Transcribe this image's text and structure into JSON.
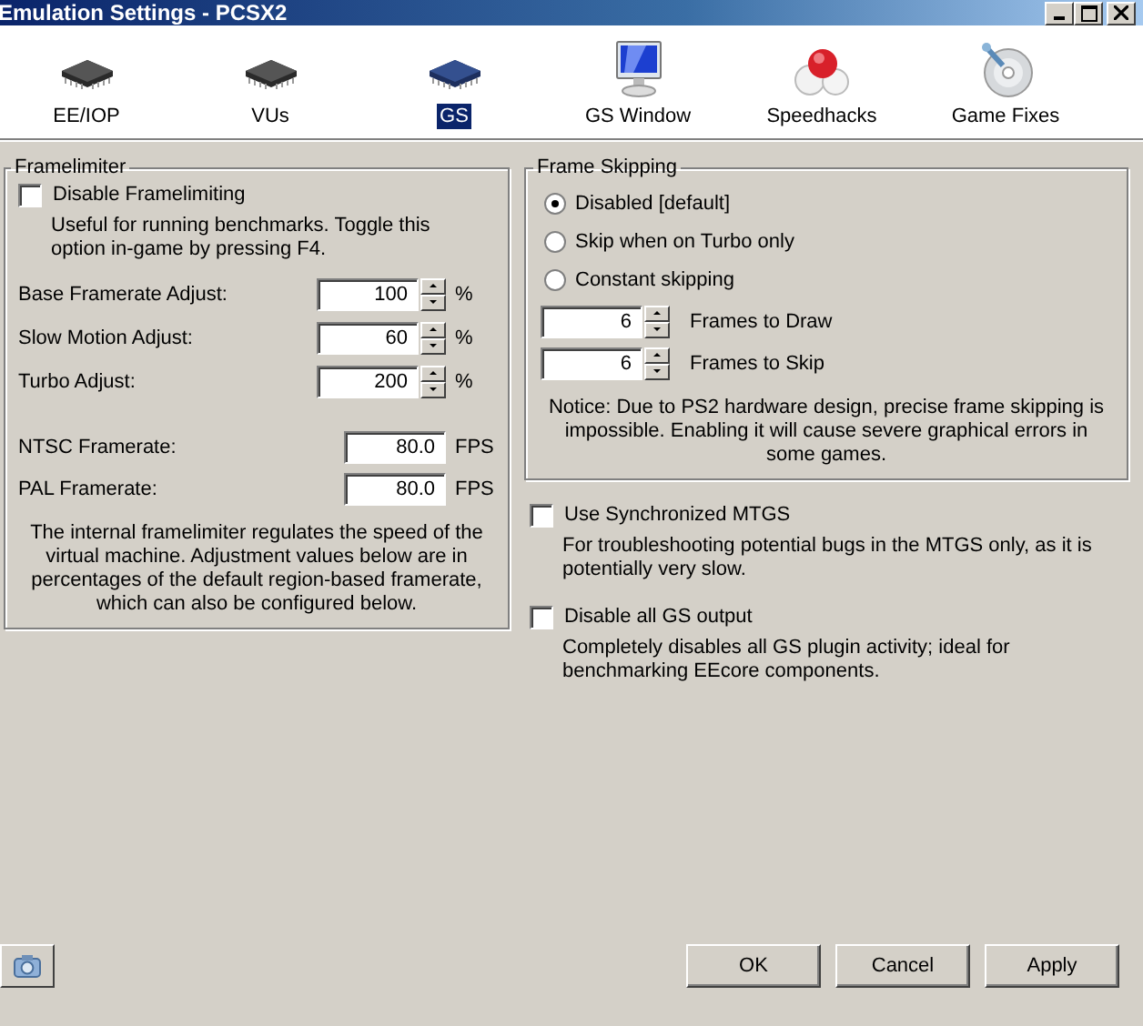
{
  "window": {
    "title": "Emulation Settings - PCSX2"
  },
  "tabs": [
    {
      "label": "EE/IOP",
      "kind": "chip",
      "selected": false
    },
    {
      "label": "VUs",
      "kind": "chip",
      "selected": false
    },
    {
      "label": "GS",
      "kind": "chip",
      "selected": true
    },
    {
      "label": "GS Window",
      "kind": "monitor",
      "selected": false
    },
    {
      "label": "Speedhacks",
      "kind": "molecule",
      "selected": false
    },
    {
      "label": "Game Fixes",
      "kind": "disc",
      "selected": false
    }
  ],
  "framelimiter": {
    "title": "Framelimiter",
    "disable": {
      "label": "Disable Framelimiting",
      "checked": false,
      "description": "Useful for running benchmarks. Toggle this option in-game by pressing F4."
    },
    "adjust": [
      {
        "label": "Base Framerate Adjust:",
        "value": "100",
        "unit": "%"
      },
      {
        "label": "Slow Motion Adjust:",
        "value": "60",
        "unit": "%"
      },
      {
        "label": "Turbo Adjust:",
        "value": "200",
        "unit": "%"
      }
    ],
    "framerates": [
      {
        "label": "NTSC Framerate:",
        "value": "80.0",
        "unit": "FPS"
      },
      {
        "label": "PAL Framerate:",
        "value": "80.0",
        "unit": "FPS"
      }
    ],
    "note": "The internal framelimiter regulates the speed of the virtual machine. Adjustment values below are in percentages of the default region-based framerate, which can also be configured below."
  },
  "frame_skipping": {
    "title": "Frame Skipping",
    "modes": [
      {
        "label": "Disabled [default]",
        "selected": true
      },
      {
        "label": "Skip when on Turbo only",
        "selected": false
      },
      {
        "label": "Constant skipping",
        "selected": false
      }
    ],
    "counts": [
      {
        "value": "6",
        "label": "Frames to Draw"
      },
      {
        "value": "6",
        "label": "Frames to Skip"
      }
    ],
    "notice": "Notice: Due to PS2 hardware design, precise frame skipping is impossible. Enabling it will cause severe graphical errors in some games."
  },
  "options": [
    {
      "label": "Use Synchronized MTGS",
      "checked": false,
      "description": "For troubleshooting potential bugs in the MTGS only, as it is potentially very slow."
    },
    {
      "label": "Disable all GS output",
      "checked": false,
      "description": "Completely disables all GS plugin activity; ideal for benchmarking EEcore components."
    }
  ],
  "buttons": [
    "OK",
    "Cancel",
    "Apply"
  ]
}
